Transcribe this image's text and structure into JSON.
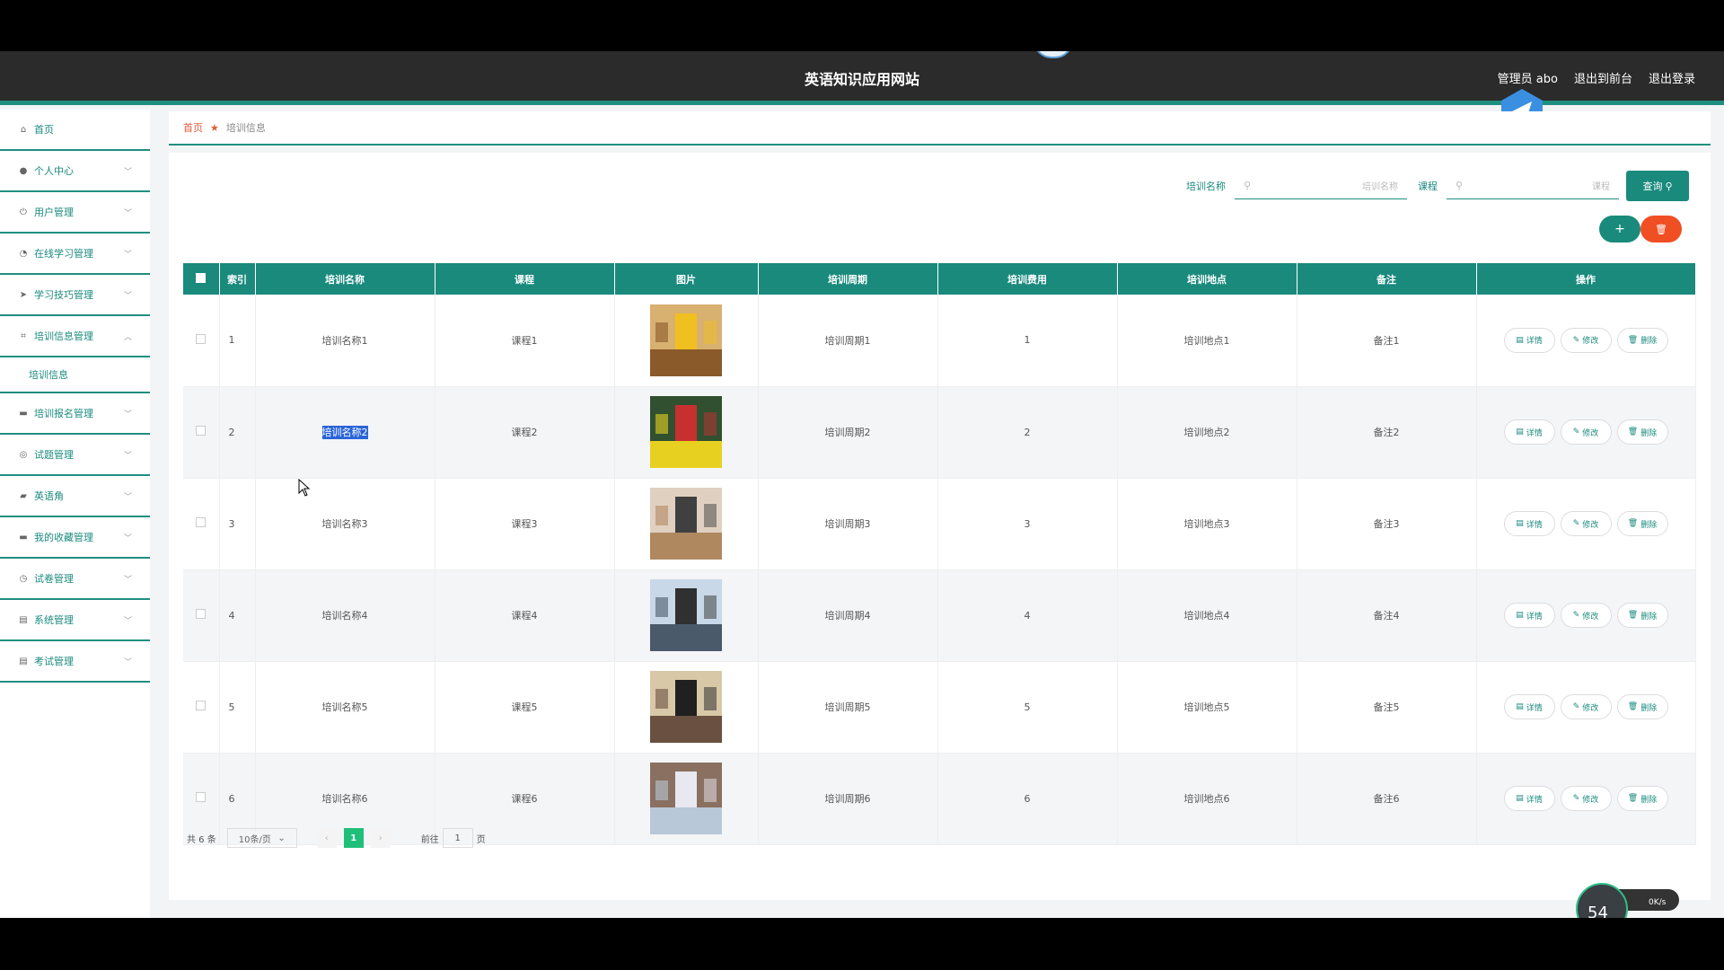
{
  "header": {
    "site_title": "英语知识应用网站",
    "admin_label": "管理员 abo",
    "to_front": "退出到前台",
    "logout": "退出登录"
  },
  "sidebar": {
    "items": [
      {
        "label": "首页",
        "icon": "home-icon"
      },
      {
        "label": "个人中心",
        "icon": "user-icon"
      },
      {
        "label": "用户管理",
        "icon": "power-icon"
      },
      {
        "label": "在线学习管理",
        "icon": "dashboard-icon"
      },
      {
        "label": "学习技巧管理",
        "icon": "send-icon"
      },
      {
        "label": "培训信息管理",
        "icon": "crop-icon"
      },
      {
        "label": "培训报名管理",
        "icon": "chat-icon"
      },
      {
        "label": "试题管理",
        "icon": "target-icon"
      },
      {
        "label": "英语角",
        "icon": "briefcase-icon"
      },
      {
        "label": "我的收藏管理",
        "icon": "folder-icon"
      },
      {
        "label": "试卷管理",
        "icon": "clock-icon"
      },
      {
        "label": "系统管理",
        "icon": "clipboard-icon"
      },
      {
        "label": "考试管理",
        "icon": "clipboard-icon"
      }
    ],
    "sub_item": "培训信息"
  },
  "breadcrumb": {
    "home": "首页",
    "current": "培训信息"
  },
  "search": {
    "name_label": "培训名称",
    "name_placeholder": "培训名称",
    "course_label": "课程",
    "course_placeholder": "课程",
    "query_label": "查询"
  },
  "table": {
    "headers": [
      "索引",
      "培训名称",
      "课程",
      "图片",
      "培训周期",
      "培训费用",
      "培训地点",
      "备注",
      "操作"
    ],
    "rows": [
      {
        "index": "1",
        "name": "培训名称1",
        "course": "课程1",
        "period": "培训周期1",
        "fee": "1",
        "place": "培训地点1",
        "note": "备注1"
      },
      {
        "index": "2",
        "name": "培训名称2",
        "course": "课程2",
        "period": "培训周期2",
        "fee": "2",
        "place": "培训地点2",
        "note": "备注2"
      },
      {
        "index": "3",
        "name": "培训名称3",
        "course": "课程3",
        "period": "培训周期3",
        "fee": "3",
        "place": "培训地点3",
        "note": "备注3"
      },
      {
        "index": "4",
        "name": "培训名称4",
        "course": "课程4",
        "period": "培训周期4",
        "fee": "4",
        "place": "培训地点4",
        "note": "备注4"
      },
      {
        "index": "5",
        "name": "培训名称5",
        "course": "课程5",
        "period": "培训周期5",
        "fee": "5",
        "place": "培训地点5",
        "note": "备注5"
      },
      {
        "index": "6",
        "name": "培训名称6",
        "course": "课程6",
        "period": "培训周期6",
        "fee": "6",
        "place": "培训地点6",
        "note": "备注6"
      }
    ],
    "op_detail": "详情",
    "op_edit": "修改",
    "op_delete": "删除"
  },
  "pager": {
    "total": "共 6 条",
    "page_size": "10条/页",
    "current_page": "1",
    "goto_prefix": "前往",
    "goto_value": "1",
    "goto_suffix": "页"
  },
  "speed_widget": {
    "percent": "54",
    "rate": "0K/s"
  },
  "colors": {
    "accent": "#1a8a7d",
    "danger": "#f04e23",
    "header_bg": "#2b2b2b"
  }
}
